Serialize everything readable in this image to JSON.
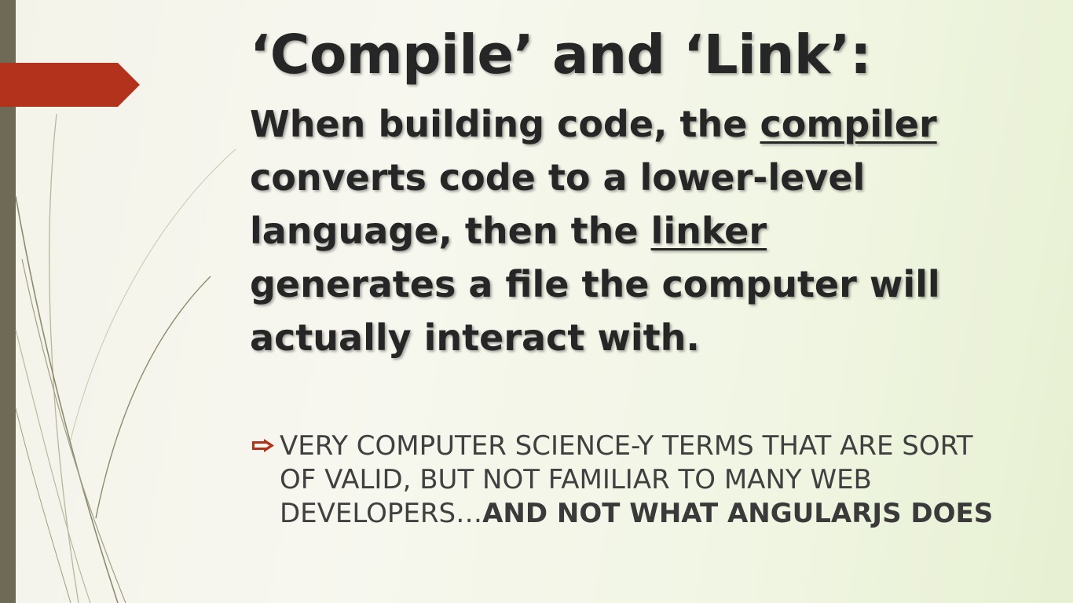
{
  "slide": {
    "title": "‘Compile’ and ‘Link’:",
    "subtitle": {
      "part1": "When building code, the ",
      "term1": "compiler",
      "part2": " converts code to a lower-level language, then the ",
      "term2": "linker",
      "part3": " generates a file the computer will actually interact with."
    },
    "bullet": {
      "text": "VERY COMPUTER SCIENCE-Y TERMS THAT ARE SORT OF VALID, BUT NOT FAMILIAR TO MANY WEB DEVELOPERS…",
      "emphasis": "AND NOT WHAT ANGULARJS DOES",
      "icon": "arrow-bullet-icon"
    }
  },
  "colors": {
    "accent": "#b3321c",
    "side_bar": "#6f6a55",
    "title_text": "#262626",
    "body_text": "#404040",
    "background": "#f5f6ec"
  }
}
